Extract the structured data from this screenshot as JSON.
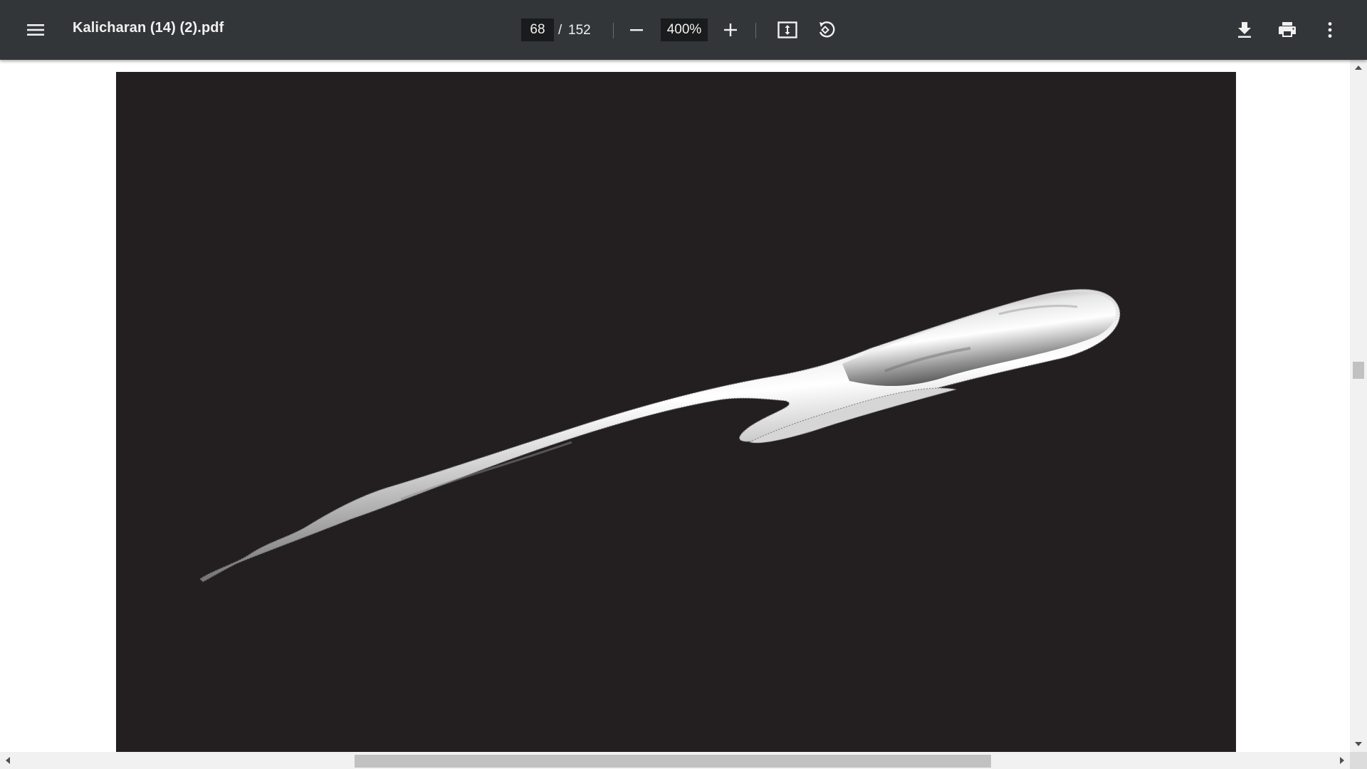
{
  "toolbar": {
    "menu_icon": "hamburger-menu-icon",
    "title": "Kalicharan (14) (2).pdf",
    "page": {
      "current": "68",
      "separator": "/",
      "total": "152"
    },
    "zoom": {
      "value": "400%",
      "zoom_out_icon": "minus-icon",
      "zoom_in_icon": "plus-icon"
    },
    "fit_icon": "fit-to-page-icon",
    "rotate_icon": "rotate-counterclockwise-icon",
    "download_icon": "download-icon",
    "print_icon": "print-icon",
    "more_icon": "more-vertical-icon"
  },
  "viewer": {
    "page_background": "#231f20",
    "figure": "grayscale 3D rendered elongated object on dark background"
  },
  "colors": {
    "toolbar_bg": "#323639",
    "toolbar_text": "#f1f1f1",
    "input_bg": "#191b1c",
    "viewer_bg": "#ffffff",
    "scrollbar_track": "#f1f1f1",
    "scrollbar_thumb": "#c1c1c1"
  }
}
